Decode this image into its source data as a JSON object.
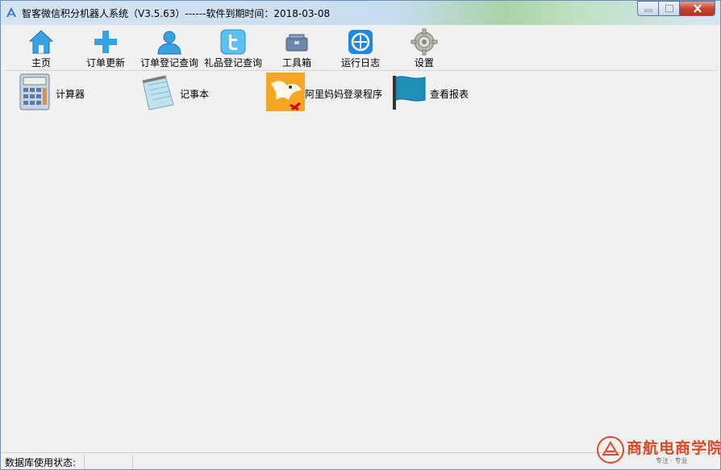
{
  "window": {
    "title": "智客微信积分机器人系统（V3.5.63）------软件到期时间：2018-03-08"
  },
  "toolbar": {
    "items": [
      {
        "label": "主页",
        "icon": "home-icon"
      },
      {
        "label": "订单更新",
        "icon": "plus-icon"
      },
      {
        "label": "订单登记查询",
        "icon": "user-icon"
      },
      {
        "label": "礼品登记查询",
        "icon": "twitter-icon"
      },
      {
        "label": "工具箱",
        "icon": "toolbox-icon"
      },
      {
        "label": "运行日志",
        "icon": "log-icon"
      },
      {
        "label": "设置",
        "icon": "gear-icon"
      }
    ]
  },
  "apps": [
    {
      "label": "计算器",
      "icon": "calculator-icon"
    },
    {
      "label": "记事本",
      "icon": "notepad-icon"
    },
    {
      "label": "阿里妈妈登录程序",
      "icon": "alimama-icon"
    },
    {
      "label": "查看报表",
      "icon": "flag-icon"
    }
  ],
  "status": {
    "db_label": "数据库使用状态:"
  },
  "watermark": {
    "main": "商航电商学院",
    "sub": "专注 · 专业"
  },
  "colors": {
    "accent_blue": "#2f8fd8",
    "close_red": "#c7452f",
    "watermark_red": "#d94a2a"
  }
}
